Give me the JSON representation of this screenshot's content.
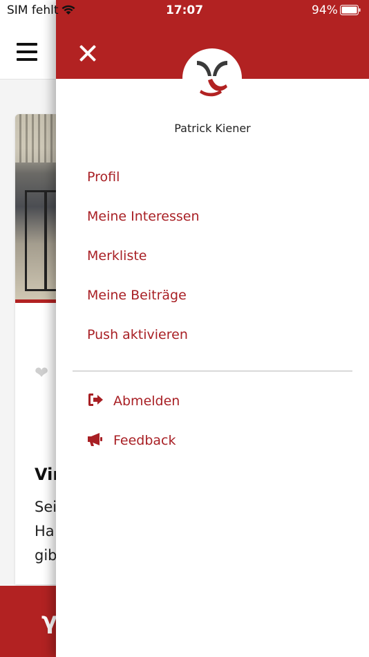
{
  "status_bar": {
    "carrier": "SIM fehlt",
    "time": "17:07",
    "battery": "94%"
  },
  "background_card": {
    "title": "Vir",
    "text_lines": [
      "Sei",
      "Ha",
      "gib"
    ]
  },
  "drawer": {
    "user_name": "Patrick Kiener",
    "menu": [
      {
        "label": "Profil"
      },
      {
        "label": "Meine Interessen"
      },
      {
        "label": "Merkliste"
      },
      {
        "label": "Meine Beiträge"
      },
      {
        "label": "Push aktivieren"
      }
    ],
    "actions": [
      {
        "label": "Abmelden",
        "icon": "sign-out-icon"
      },
      {
        "label": "Feedback",
        "icon": "megaphone-icon"
      }
    ]
  },
  "colors": {
    "brand_red": "#b22222",
    "menu_text": "#a81f24"
  }
}
